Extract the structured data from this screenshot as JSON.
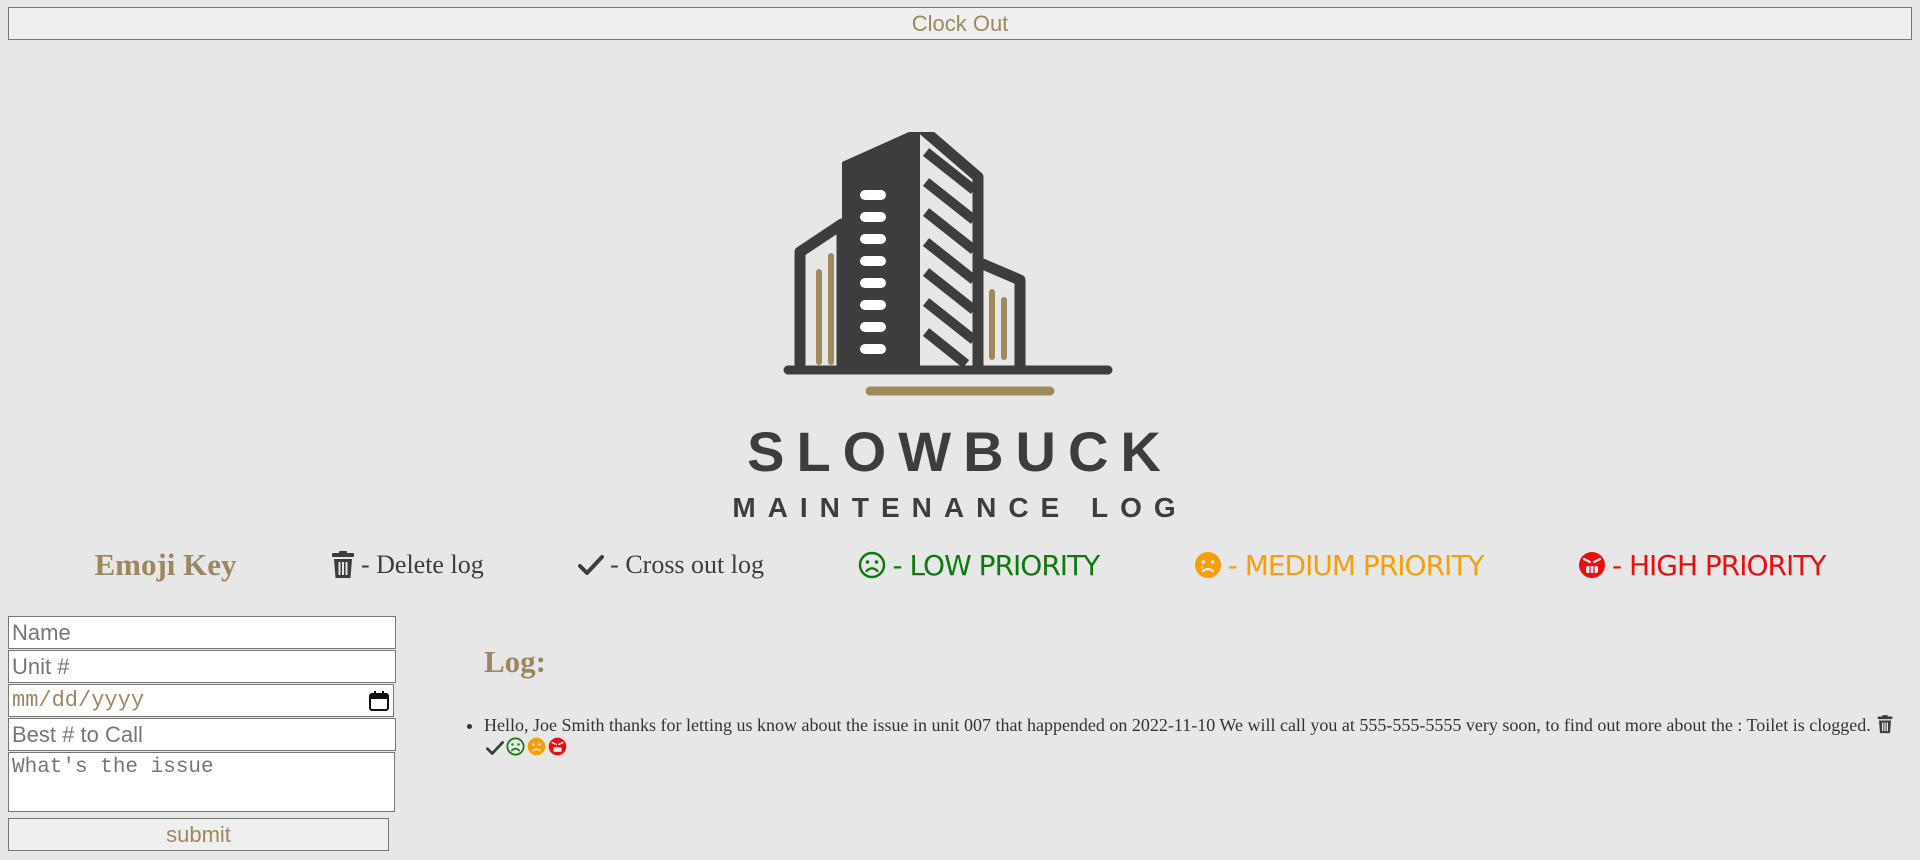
{
  "header": {
    "clock_out_label": "Clock Out"
  },
  "logo": {
    "title": "SLOWBUCK",
    "subtitle": "MAINTENANCE LOG",
    "icon": "building-logo"
  },
  "emoji_key": {
    "title": "Emoji Key",
    "items": [
      {
        "icon": "trash-icon",
        "label": "- Delete log"
      },
      {
        "icon": "check-icon",
        "label": "- Cross out log"
      },
      {
        "icon": "frown-icon",
        "label": "- LOW PRIORITY",
        "color": "#0d7a0d"
      },
      {
        "icon": "sad-tear-icon",
        "label": "- MEDIUM PRIORITY",
        "color": "#f5a00b"
      },
      {
        "icon": "angry-icon",
        "label": "- HIGH PRIORITY",
        "color": "#ea0f0f"
      }
    ]
  },
  "form": {
    "name_placeholder": "Name",
    "unit_placeholder": "Unit #",
    "date_placeholder": "mm/dd/yyyy",
    "phone_placeholder": "Best # to Call",
    "issue_placeholder": "What's the issue",
    "submit_label": "submit"
  },
  "log": {
    "heading": "Log:",
    "entries": [
      {
        "text": "Hello, Joe Smith thanks for letting us know about the issue in unit 007 that happended on 2022-11-10 We will call you at 555-555-5555 very soon, to find out more about the : Toilet is clogged."
      }
    ]
  },
  "colors": {
    "accent": "#9c8860",
    "dark": "#3d3d3d",
    "background": "#e7e7e7"
  }
}
